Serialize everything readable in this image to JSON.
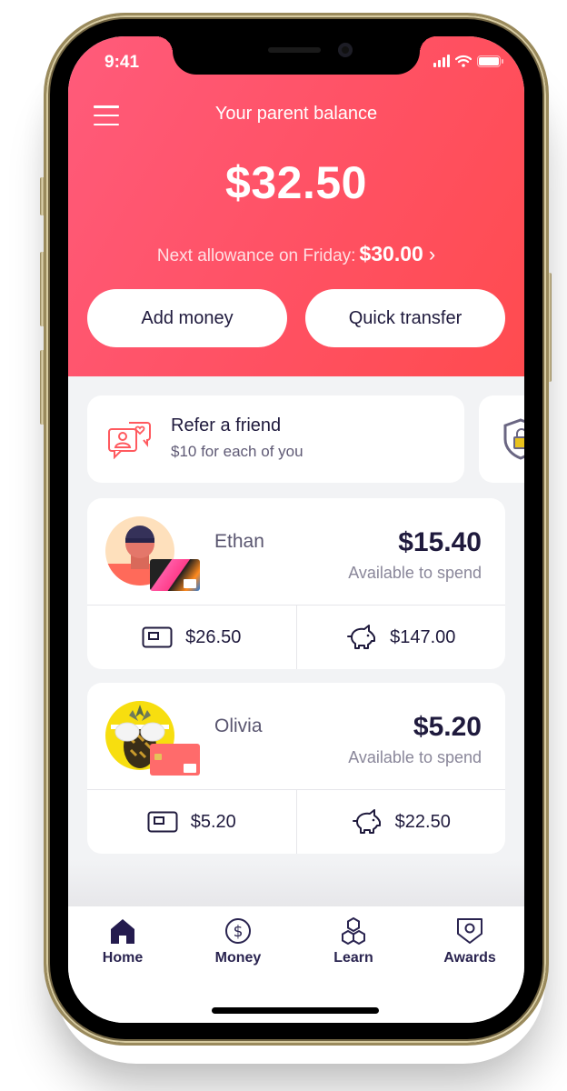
{
  "status_bar": {
    "time": "9:41"
  },
  "header": {
    "title": "Your parent balance",
    "balance": "$32.50",
    "allowance_label": "Next allowance on Friday:",
    "allowance_amount": "$30.00",
    "allowance_chevron": "›"
  },
  "actions": {
    "add_money": "Add money",
    "quick_transfer": "Quick transfer"
  },
  "promos": [
    {
      "title": "Refer a friend",
      "subtitle": "$10 for each of you",
      "icon": "refer-chat-icon"
    },
    {
      "icon": "shield-lock-icon"
    }
  ],
  "kids": [
    {
      "name": "Ethan",
      "available": "$15.40",
      "available_label": "Available to spend",
      "card_balance": "$26.50",
      "savings_balance": "$147.00"
    },
    {
      "name": "Olivia",
      "available": "$5.20",
      "available_label": "Available to spend",
      "card_balance": "$5.20",
      "savings_balance": "$22.50"
    }
  ],
  "colors": {
    "accent": "#ff5163",
    "text_dark": "#1f1a3d",
    "nav": "#2a2450"
  },
  "tabbar": {
    "items": [
      {
        "label": "Home",
        "icon": "home-icon",
        "active": true
      },
      {
        "label": "Money",
        "icon": "dollar-circle-icon"
      },
      {
        "label": "Learn",
        "icon": "hexagons-icon"
      },
      {
        "label": "Awards",
        "icon": "shield-badge-icon"
      }
    ]
  }
}
